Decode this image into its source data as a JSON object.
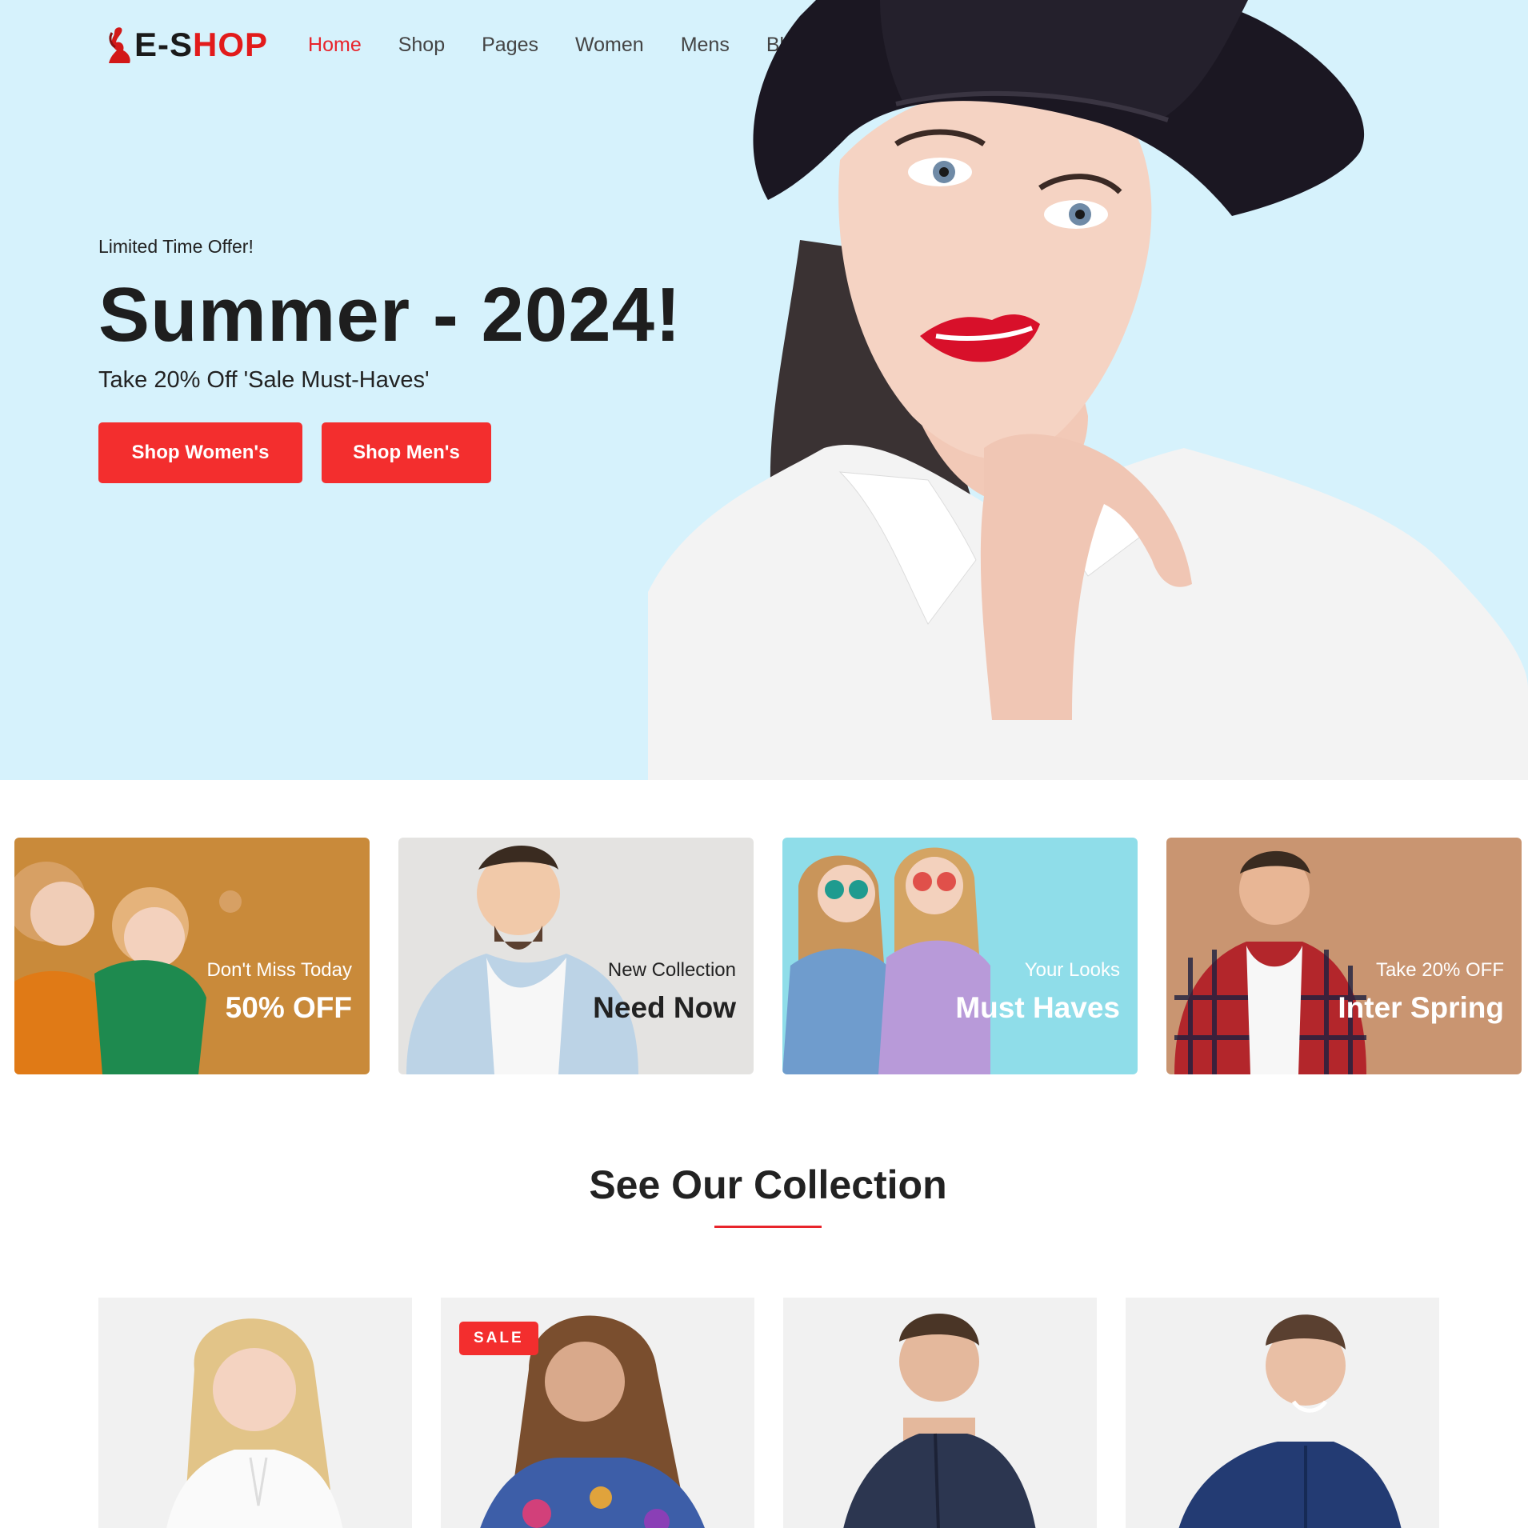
{
  "brand": {
    "logo_prefix": "E-S",
    "logo_suffix": "HOP",
    "accent_color": "#f32e2e",
    "hero_bg": "#d6f2fc"
  },
  "nav": {
    "items": [
      {
        "label": "Home",
        "active": true
      },
      {
        "label": "Shop",
        "active": false
      },
      {
        "label": "Pages",
        "active": false
      },
      {
        "label": "Women",
        "active": false
      },
      {
        "label": "Mens",
        "active": false
      },
      {
        "label": "Blog",
        "active": false
      }
    ]
  },
  "hero": {
    "eyebrow": "Limited Time Offer!",
    "headline": "Summer - 2024!",
    "subheadline": "Take 20% Off 'Sale Must-Haves'",
    "primary_button": "Shop Women's",
    "secondary_button": "Shop Men's",
    "image": "woman-in-black-hat"
  },
  "promos": [
    {
      "small": "Don't Miss Today",
      "big": "50% OFF",
      "bg": "#c98a3a",
      "text_color": "#ffffff",
      "image": "two-women-surprised"
    },
    {
      "small": "New Collection",
      "big": "Need Now",
      "bg": "#e4e3e1",
      "text_color": "#222222",
      "image": "man-in-light-shirt"
    },
    {
      "small": "Your Looks",
      "big": "Must Haves",
      "bg": "#8fdde9",
      "text_color": "#ffffff",
      "image": "two-women-sunglasses"
    },
    {
      "small": "Take 20% OFF",
      "big": "Inter Spring",
      "bg": "#c99571",
      "text_color": "#ffffff",
      "image": "man-in-plaid-shirt"
    }
  ],
  "collection": {
    "title": "See Our Collection",
    "products": [
      {
        "image": "blonde-woman-white-blouse",
        "badge": ""
      },
      {
        "image": "woman-patterned-top",
        "badge": "SALE"
      },
      {
        "image": "man-navy-jacket",
        "badge": ""
      },
      {
        "image": "man-blue-shirt",
        "badge": ""
      }
    ]
  }
}
